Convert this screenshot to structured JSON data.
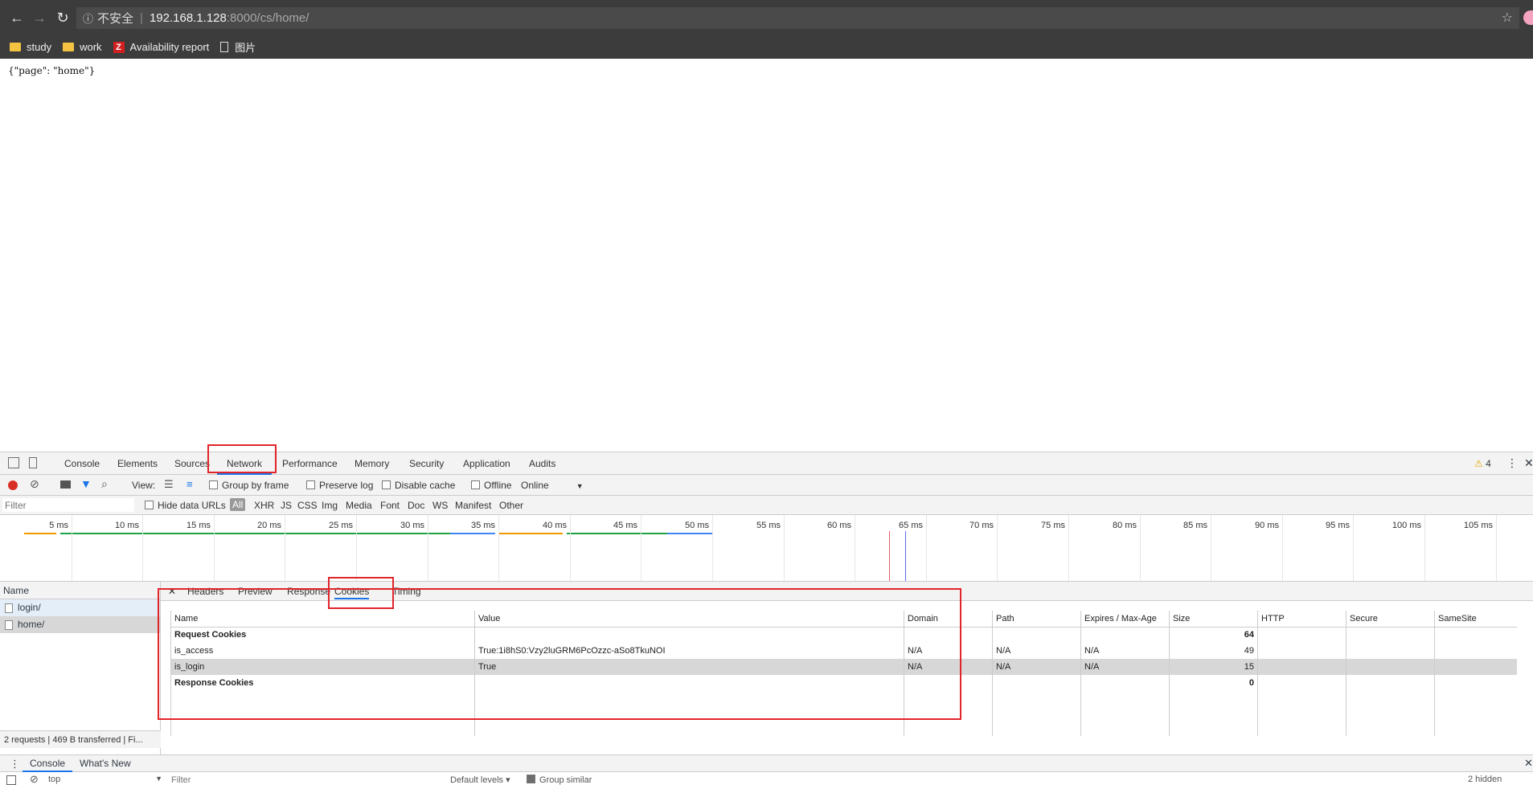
{
  "browser": {
    "security_label": "不安全",
    "url_host": "192.168.1.128",
    "url_path": ":8000/cs/home/",
    "bookmarks": [
      {
        "label": "study",
        "icon": "folder-icon"
      },
      {
        "label": "work",
        "icon": "folder-icon"
      },
      {
        "label": "Availability report",
        "icon": "z-icon"
      },
      {
        "label": "图片",
        "icon": "document-icon"
      }
    ]
  },
  "page": {
    "body_text": "{\"page\": \"home\"}"
  },
  "devtools": {
    "tabs": [
      "Console",
      "Elements",
      "Sources",
      "Network",
      "Performance",
      "Memory",
      "Security",
      "Application",
      "Audits"
    ],
    "warning_count": "4",
    "toolbar": {
      "view_label": "View:",
      "group_by_frame": "Group by frame",
      "preserve_log": "Preserve log",
      "disable_cache": "Disable cache",
      "offline": "Offline",
      "throttle": "Online"
    },
    "filter": {
      "placeholder": "Filter",
      "hide_data_urls": "Hide data URLs",
      "types": [
        "All",
        "XHR",
        "JS",
        "CSS",
        "Img",
        "Media",
        "Font",
        "Doc",
        "WS",
        "Manifest",
        "Other"
      ]
    },
    "timeline": {
      "ticks": [
        "5 ms",
        "10 ms",
        "15 ms",
        "20 ms",
        "25 ms",
        "30 ms",
        "35 ms",
        "40 ms",
        "45 ms",
        "50 ms",
        "55 ms",
        "60 ms",
        "65 ms",
        "70 ms",
        "75 ms",
        "80 ms",
        "85 ms",
        "90 ms",
        "95 ms",
        "100 ms",
        "105 ms"
      ]
    },
    "requests": {
      "header": "Name",
      "items": [
        "login/",
        "home/"
      ],
      "status": "2 requests | 469 B transferred | Fi..."
    },
    "detail_tabs": [
      "Headers",
      "Preview",
      "Response",
      "Cookies",
      "Timing"
    ],
    "cookies": {
      "columns": [
        "Name",
        "Value",
        "Domain",
        "Path",
        "Expires / Max-Age",
        "Size",
        "HTTP",
        "Secure",
        "SameSite"
      ],
      "request_label": "Request Cookies",
      "request_size": "64",
      "rows": [
        {
          "name": "is_access",
          "value": "True:1i8hS0:Vzy2luGRM6PcOzzc-aSo8TkuNOI",
          "domain": "N/A",
          "path": "N/A",
          "expires": "N/A",
          "size": "49"
        },
        {
          "name": "is_login",
          "value": "True",
          "domain": "N/A",
          "path": "N/A",
          "expires": "N/A",
          "size": "15"
        }
      ],
      "response_label": "Response Cookies",
      "response_size": "0"
    },
    "drawer": {
      "tabs": [
        "Console",
        "What's New"
      ],
      "context": "top",
      "filter_placeholder": "Filter",
      "levels": "Default levels ▾",
      "group_similar": "Group similar",
      "hidden": "2 hidden"
    }
  }
}
